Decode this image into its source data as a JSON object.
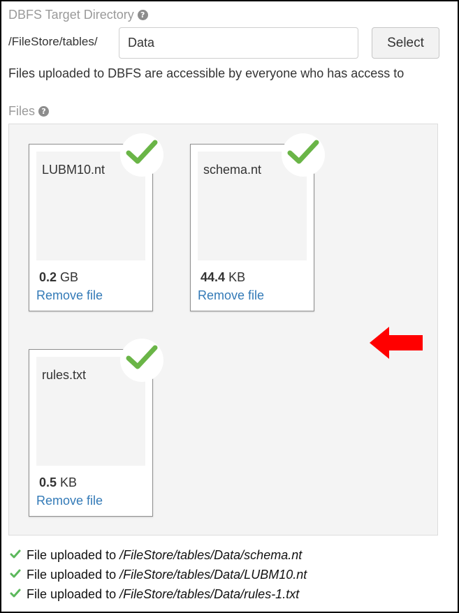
{
  "target_dir": {
    "title": "DBFS Target Directory",
    "help_icon": "question-circle-icon",
    "prefix": "/FileStore/tables/",
    "input_value": "Data",
    "select_label": "Select",
    "note": "Files uploaded to DBFS are accessible by everyone who has access to"
  },
  "files_section": {
    "title": "Files",
    "help_icon": "question-circle-icon",
    "files": [
      {
        "name": "LUBM10.nt",
        "size_value": "0.2",
        "size_unit": "GB",
        "remove_label": "Remove file",
        "status_icon": "check-icon"
      },
      {
        "name": "schema.nt",
        "size_value": "44.4",
        "size_unit": "KB",
        "remove_label": "Remove file",
        "status_icon": "check-icon"
      },
      {
        "name": "rules.txt",
        "size_value": "0.5",
        "size_unit": "KB",
        "remove_label": "Remove file",
        "status_icon": "check-icon"
      }
    ]
  },
  "upload_status": [
    {
      "text": "File uploaded to",
      "path": "/FileStore/tables/Data/schema.nt"
    },
    {
      "text": "File uploaded to",
      "path": "/FileStore/tables/Data/LUBM10.nt"
    },
    {
      "text": "File uploaded to",
      "path": "/FileStore/tables/Data/rules-1.txt"
    }
  ],
  "colors": {
    "accent_link": "#337ab7",
    "success_green": "#6ab547",
    "arrow_red": "#ff0000",
    "muted_label": "#9a9a9a"
  },
  "annotation_icon": "left-arrow-icon"
}
